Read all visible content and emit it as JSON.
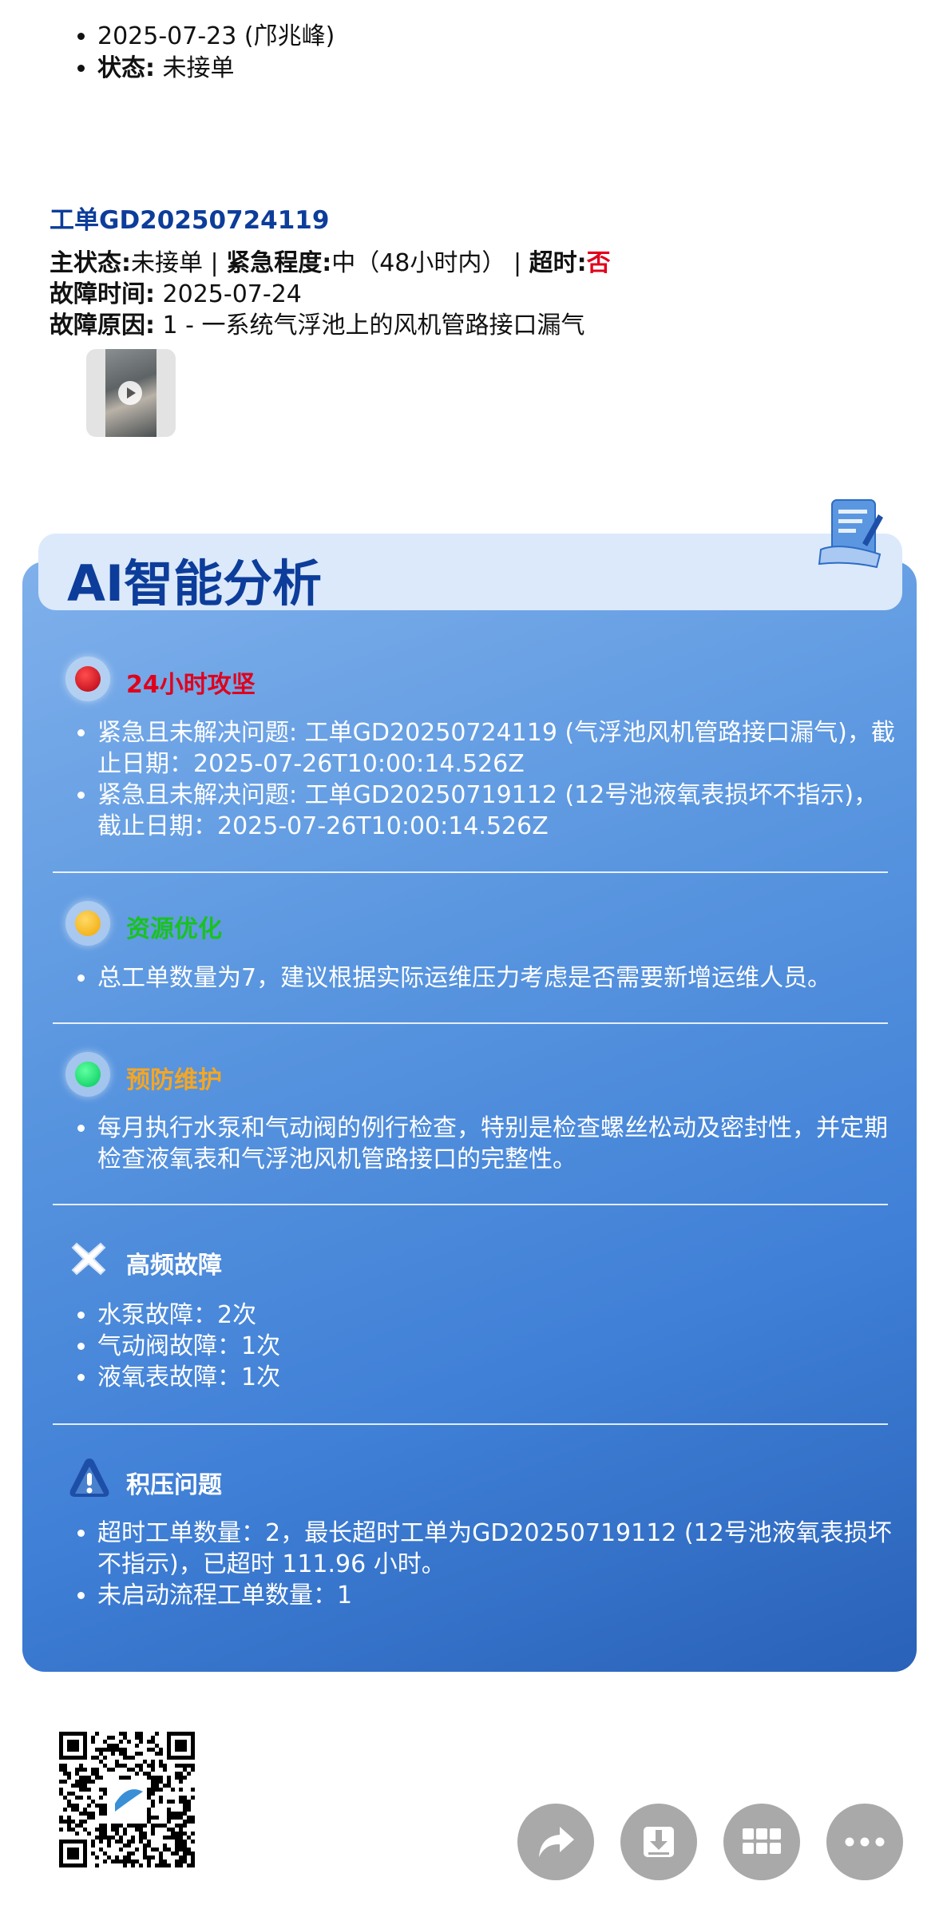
{
  "previous_item": {
    "date_line": "2025-07-23 (邝兆峰)",
    "status_label": "状态:",
    "status_value": "未接单"
  },
  "work_order": {
    "id": "工单GD20250724119",
    "main_status_label": "主状态:",
    "main_status_value": "未接单",
    "sep1": "|",
    "urgency_label": "紧急程度:",
    "urgency_value": "中（48小时内）",
    "sep2": "|",
    "timeout_label": "超时:",
    "timeout_value": "否",
    "fault_time_label": "故障时间:",
    "fault_time_value": "2025-07-24",
    "fault_reason_label": "故障原因:",
    "fault_reason_value": "1 - 一系统气浮池上的风机管路接口漏气"
  },
  "ai_analysis": {
    "title": "AI智能分析",
    "sections": [
      {
        "title": "24小时攻坚",
        "title_color": "#e0001b",
        "icon": "red-circle-icon",
        "items": [
          "紧急且未解决问题: 工单GD20250724119 (气浮池风机管路接口漏气)，截止日期：2025-07-26T10:00:14.526Z",
          "紧急且未解决问题: 工单GD20250719112 (12号池液氧表损坏不指示)，截止日期：2025-07-26T10:00:14.526Z"
        ]
      },
      {
        "title": "资源优化",
        "title_color": "#19c21f",
        "icon": "yellow-circle-icon",
        "items": [
          "总工单数量为7，建议根据实际运维压力考虑是否需要新增运维人员。"
        ]
      },
      {
        "title": "预防维护",
        "title_color": "#f5a623",
        "icon": "green-circle-icon",
        "items": [
          "每月执行水泵和气动阀的例行检查，特别是检查螺丝松动及密封性，并定期检查液氧表和气浮池风机管路接口的完整性。"
        ]
      },
      {
        "title": "高频故障",
        "title_color": "#ffffff",
        "icon": "cross-icon",
        "items": [
          "水泵故障：2次",
          "气动阀故障：1次",
          "液氧表故障：1次"
        ]
      },
      {
        "title": "积压问题",
        "title_color": "#ffffff",
        "icon": "warning-icon",
        "items": [
          "超时工单数量：2，最长超时工单为GD20250719112 (12号池液氧表损坏不指示)，已超时 111.96 小时。",
          "未启动流程工单数量：1"
        ]
      }
    ]
  },
  "footer": {
    "qr_icon": "qr-code-icon",
    "actions": [
      "share-icon",
      "download-icon",
      "apps-icon",
      "more-icon"
    ]
  }
}
